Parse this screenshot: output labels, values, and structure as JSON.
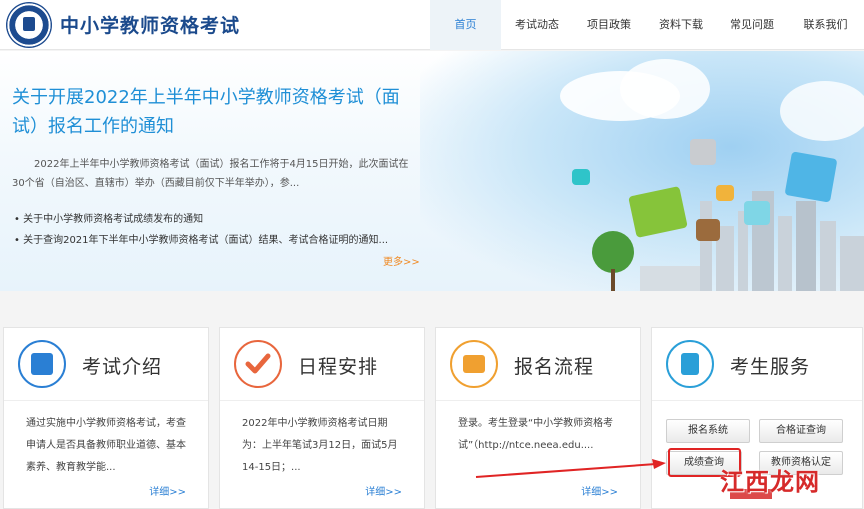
{
  "header": {
    "site_title": "中小学教师资格考试",
    "nav": [
      {
        "label": "首页",
        "active": true
      },
      {
        "label": "考试动态"
      },
      {
        "label": "项目政策"
      },
      {
        "label": "资料下载"
      },
      {
        "label": "常见问题"
      },
      {
        "label": "联系我们"
      }
    ]
  },
  "banner": {
    "headline": "关于开展2022年上半年中小学教师资格考试（面试）报名工作的通知",
    "summary": "2022年上半年中小学教师资格考试（面试）报名工作将于4月15日开始，此次面试在30个省（自治区、直辖市）举办（西藏目前仅下半年举办），参...",
    "news": [
      "关于中小学教师资格考试成绩发布的通知",
      "关于查询2021年下半年中小学教师资格考试（面试）结果、考试合格证明的通知..."
    ],
    "more": "更多>>"
  },
  "cards": [
    {
      "title": "考试介绍",
      "text": "通过实施中小学教师资格考试，考查申请人是否具备教师职业道德、基本素养、教育教学能...",
      "more": "详细>>",
      "icon": "document-edit-icon",
      "color": "#2a7fd4"
    },
    {
      "title": "日程安排",
      "text": "2022年中小学教师资格考试日期为：上半年笔试3月12日，面试5月14-15日；...",
      "more": "详细>>",
      "icon": "checkmark-icon",
      "color": "#e8663d"
    },
    {
      "title": "报名流程",
      "text": "登录。考生登录“中小学教师资格考试”（http://ntce.neea.edu....",
      "more": "详细>>",
      "icon": "registration-form-icon",
      "color": "#f0a030"
    },
    {
      "title": "考生服务",
      "icon": "contacts-book-icon",
      "color": "#2a9fd8",
      "buttons": [
        "报名系统",
        "合格证查询",
        "成绩查询",
        "教师资格认定"
      ]
    }
  ],
  "watermark": "江西龙网",
  "colors": {
    "brand": "#1b4a8c",
    "accent": "#1f8fd6",
    "more": "#f08a24",
    "annotation": "#e02424"
  }
}
